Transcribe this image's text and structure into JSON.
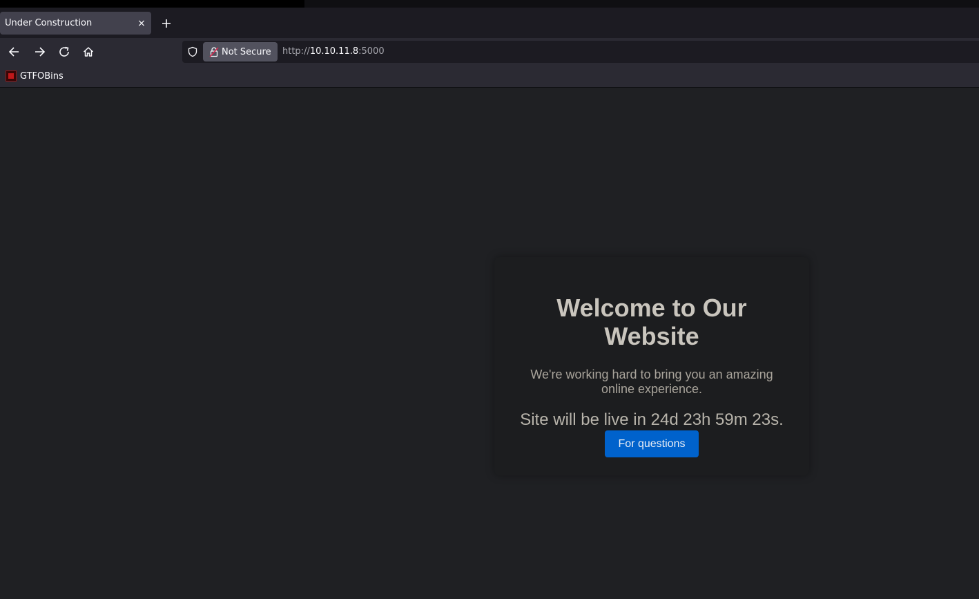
{
  "browser": {
    "tab": {
      "title": "Under Construction",
      "close_glyph": "×"
    },
    "new_tab_icon": "plus-icon",
    "nav_icons": [
      "back-arrow-icon",
      "forward-arrow-icon",
      "reload-icon",
      "home-icon"
    ],
    "security_label": "Not Secure",
    "url": {
      "scheme": "http://",
      "host": "10.10.11.8",
      "port": ":5000"
    },
    "bookmarks": [
      {
        "label": "GTFOBins"
      }
    ]
  },
  "page": {
    "heading": "Welcome to Our Website",
    "lead": "We're working hard to bring you an amazing online experience.",
    "countdown": "Site will be live in 24d 23h 59m 23s.",
    "button_label": "For questions"
  },
  "colors": {
    "accent_button": "#0062cc",
    "page_background": "#1f2023",
    "toolbar": "#2b2a33"
  }
}
